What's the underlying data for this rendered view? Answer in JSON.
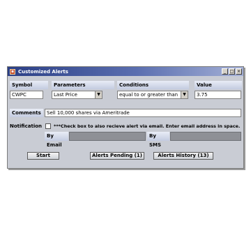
{
  "window": {
    "title": "Customized Alerts"
  },
  "headers": {
    "symbol": "Symbol",
    "parameters": "Parameters",
    "conditions": "Conditions",
    "value": "Value"
  },
  "fields": {
    "symbol_value": "CWPC",
    "parameter_selected": "Last Price",
    "condition_selected": "equal to or greater than",
    "value_value": "3.75"
  },
  "comments": {
    "label": "Comments",
    "value": "Sell 10,000 shares via Ameritrade"
  },
  "notification": {
    "label": "Notification",
    "checked": false,
    "note": "***Check box to also recieve alert via email. Enter email address in space.",
    "by_email_label": "By Email",
    "by_sms_label": "By SMS"
  },
  "buttons": {
    "start": "Start",
    "alerts_pending": "Alerts Pending (1)",
    "alerts_history": "Alerts History (13)"
  },
  "colors": {
    "titlebar_start": "#2b3f86",
    "window_bg": "#c9ccd4",
    "disabled_field": "#8e9096"
  }
}
